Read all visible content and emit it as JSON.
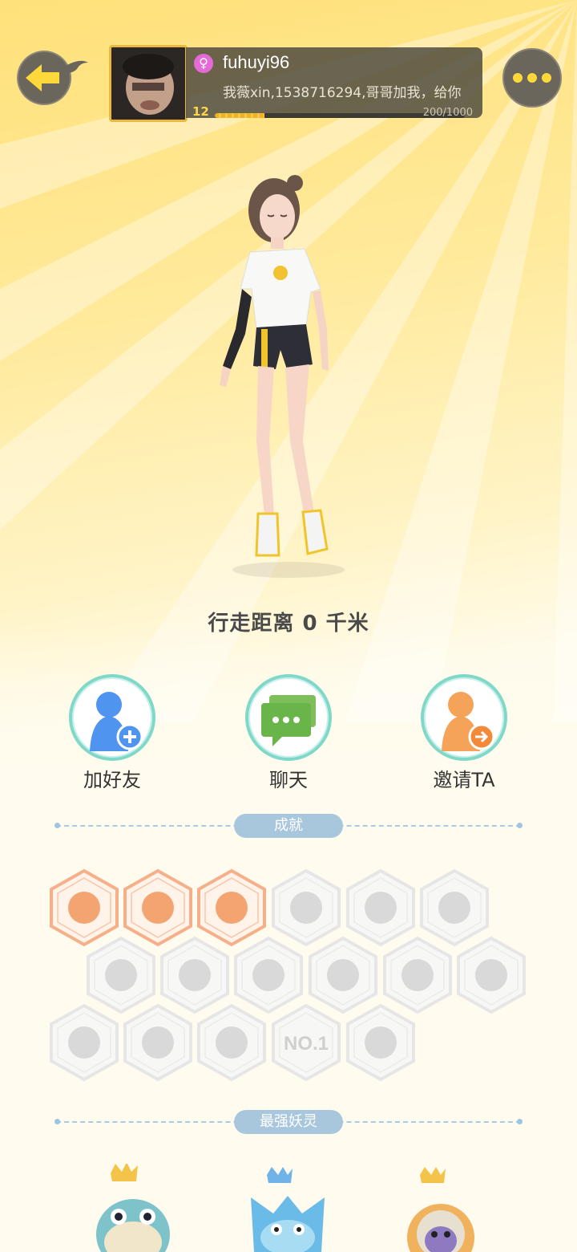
{
  "header": {
    "username": "fuhuyi96",
    "gender_symbol": "♀",
    "signature": "我薇xin,1538716294,哥哥加我，给你",
    "level": "12",
    "exp_text": "200/1000",
    "exp_progress": 0.2
  },
  "distance_text": "行走距离 0 千米",
  "actions": [
    {
      "label": "加好友",
      "icon": "add-friend-icon"
    },
    {
      "label": "聊天",
      "icon": "chat-icon"
    },
    {
      "label": "邀请TA",
      "icon": "invite-icon"
    }
  ],
  "sections": {
    "achievements": "成就",
    "strongest": "最强妖灵"
  },
  "achievements": {
    "unlocked_count": 3,
    "total": 17,
    "badge5_text": "NO.1"
  },
  "colors": {
    "accent_yellow": "#ffd83a",
    "action_ring": "#7fd8c8",
    "section_pill": "#a9c7dc",
    "unlocked_badge": "#f5b08a",
    "locked_badge": "#e9e9e9"
  }
}
